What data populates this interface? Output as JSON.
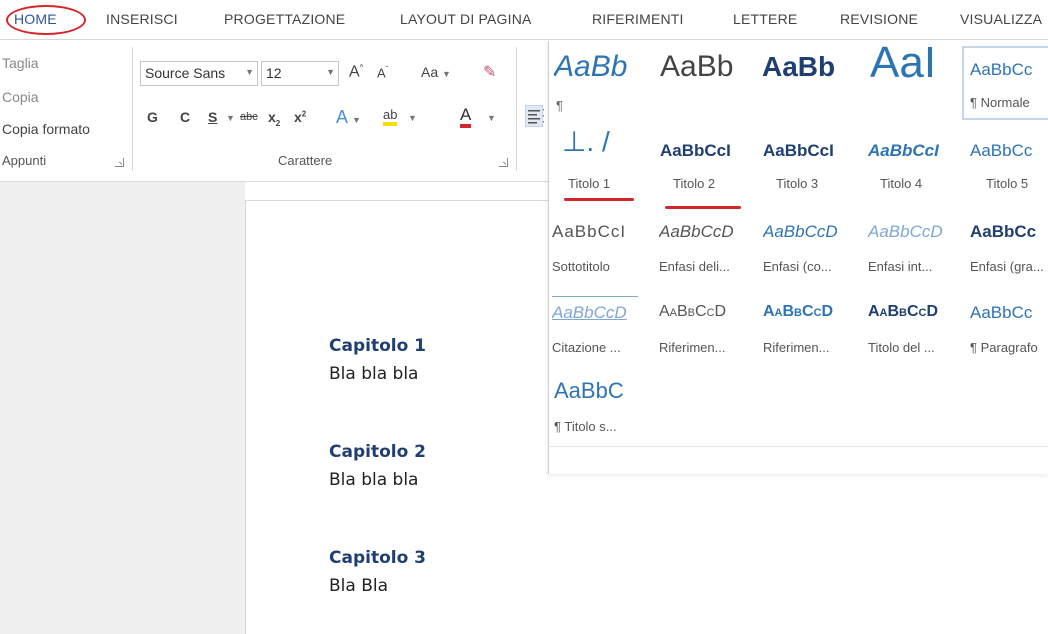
{
  "tabs": [
    {
      "label": "HOME",
      "active": true
    },
    {
      "label": "INSERISCI"
    },
    {
      "label": "PROGETTAZIONE"
    },
    {
      "label": "LAYOUT DI PAGINA"
    },
    {
      "label": "RIFERIMENTI"
    },
    {
      "label": "LETTERE"
    },
    {
      "label": "REVISIONE"
    },
    {
      "label": "VISUALIZZA"
    }
  ],
  "clipboard": {
    "cut": "Taglia",
    "copy": "Copia",
    "format_painter": "Copia formato",
    "group_label": "Appunti"
  },
  "font": {
    "name": "Source Sans",
    "size": "12",
    "grow": "A",
    "shrink": "A",
    "change_case": "Aa",
    "bold": "G",
    "italic": "C",
    "underline": "S",
    "strikethrough": "abc",
    "subscript": "x",
    "superscript": "x",
    "effects": "A",
    "highlight": "ab",
    "font_color": "A",
    "group_label": "Carattere"
  },
  "styles": [
    {
      "preview": "AaBb",
      "label": "¶",
      "id": "enfasi-preview"
    },
    {
      "preview": "AaBb",
      "label": "",
      "id": "aabb-light"
    },
    {
      "preview": "AaBb",
      "label": "",
      "id": "aabb-bold"
    },
    {
      "preview": "AaI",
      "label": "",
      "id": "aai-large"
    },
    {
      "preview": "AaBbCc",
      "label": "¶ Normale",
      "id": "normale"
    },
    {
      "preview": "⊥. /",
      "label": "Titolo 1",
      "id": "titolo-1"
    },
    {
      "preview": "AaBbCcI",
      "label": "Titolo 2",
      "id": "titolo-2"
    },
    {
      "preview": "AaBbCcI",
      "label": "Titolo 3",
      "id": "titolo-3"
    },
    {
      "preview": "AaBbCcI",
      "label": "Titolo 4",
      "id": "titolo-4"
    },
    {
      "preview": "AaBbCc",
      "label": "Titolo 5",
      "id": "titolo-5"
    },
    {
      "preview": "AaBbCcI",
      "label": "Sottotitolo",
      "id": "sottotitolo"
    },
    {
      "preview": "AaBbCcD",
      "label": "Enfasi deli...",
      "id": "enfasi-delicata"
    },
    {
      "preview": "AaBbCcD",
      "label": "Enfasi (co...",
      "id": "enfasi-corsivo"
    },
    {
      "preview": "AaBbCcD",
      "label": "Enfasi int...",
      "id": "enfasi-intensa"
    },
    {
      "preview": "AaBbCc",
      "label": "Enfasi (gra...",
      "id": "enfasi-grassetto"
    },
    {
      "preview": "AaBbCcD",
      "label": "Citazione ...",
      "id": "citazione"
    },
    {
      "preview": "AaBbCcD",
      "label": "Riferimen...",
      "id": "riferimento-delicato"
    },
    {
      "preview": "AaBbCcD",
      "label": "Riferimen...",
      "id": "riferimento-intenso"
    },
    {
      "preview": "AaBbCcD",
      "label": "Titolo del ...",
      "id": "titolo-libro"
    },
    {
      "preview": "AaBbCc",
      "label": "¶ Paragrafo",
      "id": "paragrafo"
    },
    {
      "preview": "AaBbC",
      "label": "¶ Titolo s...",
      "id": "titolo-sommario"
    }
  ],
  "document": [
    {
      "heading": "Capitolo 1",
      "body": "Bla bla bla"
    },
    {
      "heading": "Capitolo 2",
      "body": "Bla bla bla"
    },
    {
      "heading": "Capitolo 3",
      "body": "Bla Bla"
    }
  ],
  "colors": {
    "accent": "#2b579a",
    "annotation_red": "#d6252b",
    "heading_blue": "#1f3f73",
    "style_blue": "#2e74b5"
  }
}
